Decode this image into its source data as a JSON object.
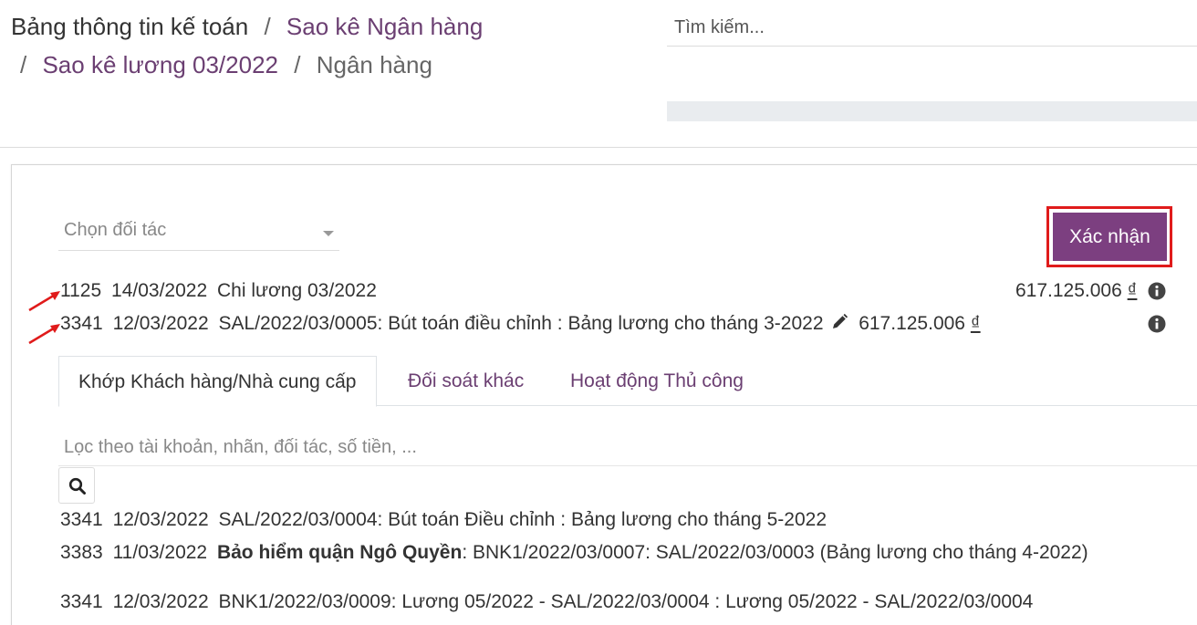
{
  "breadcrumb": {
    "root": "Bảng thông tin kế toán",
    "level1": "Sao kê Ngân hàng",
    "level2": "Sao kê lương 03/2022",
    "current": "Ngân hàng",
    "separator": "/"
  },
  "search": {
    "placeholder": "Tìm kiếm..."
  },
  "partner_select": {
    "placeholder": "Chọn đối tác"
  },
  "confirm_button": {
    "label": "Xác nhận"
  },
  "statement_line": {
    "account": "1125",
    "date": "14/03/2022",
    "label": "Chi lương 03/2022",
    "amount": "617.125.006",
    "currency": "₫"
  },
  "matched_line": {
    "account": "3341",
    "date": "12/03/2022",
    "label": "SAL/2022/03/0005: Bút toán điều chỉnh : Bảng lương cho tháng 3-2022",
    "amount": "617.125.006",
    "currency": "₫"
  },
  "tabs": [
    {
      "label": "Khớp Khách hàng/Nhà cung cấp",
      "active": true
    },
    {
      "label": "Đối soát khác",
      "active": false
    },
    {
      "label": "Hoạt động Thủ công",
      "active": false
    }
  ],
  "filter": {
    "placeholder": "Lọc theo tài khoản, nhãn, đối tác, số tiền, ..."
  },
  "candidates": [
    {
      "account": "3341",
      "date": "12/03/2022",
      "partner": "",
      "label": "SAL/2022/03/0004: Bút toán Điều chỉnh : Bảng lương cho tháng 5-2022"
    },
    {
      "account": "3383",
      "date": "11/03/2022",
      "partner": "Bảo hiểm quận Ngô Quyền",
      "label": ": BNK1/2022/03/0007: SAL/2022/03/0003 (Bảng lương cho tháng 4-2022)"
    },
    {
      "account": "3341",
      "date": "12/03/2022",
      "partner": "",
      "label": "BNK1/2022/03/0009: Lương 05/2022 - SAL/2022/03/0004 : Lương 05/2022 - SAL/2022/03/0004"
    }
  ],
  "colors": {
    "brand": "#7c3f80",
    "link": "#6b3f72",
    "highlight": "#e01b1b"
  },
  "icons": {
    "info": "info-circle-icon",
    "edit": "pencil-icon",
    "search": "magnifier-icon",
    "annotation": "red-arrow-icon"
  }
}
